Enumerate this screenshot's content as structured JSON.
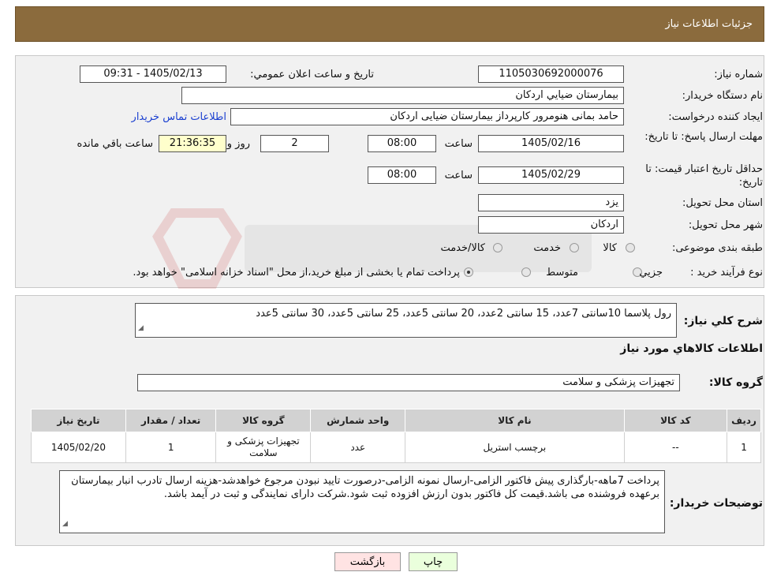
{
  "header": {
    "title": "جزئیات اطلاعات نیاز"
  },
  "form": {
    "need_number": {
      "label": "شماره نیاز:",
      "value": "1105030692000076"
    },
    "announce_datetime": {
      "label": "تاریخ و ساعت اعلان عمومي:",
      "value": "1405/02/13 - 09:31"
    },
    "buyer_org": {
      "label": "نام دستگاه خريدار:",
      "value": "بيمارستان ضيايي اردكان"
    },
    "requester": {
      "label": "ايجاد كننده درخواست:",
      "value": "حامد بمانی هنومرور کارپرداز بیمارستان ضیایی اردکان",
      "contact_link": "اطلاعات تماس خريدار"
    },
    "reply_deadline": {
      "label": "مهلت ارسال پاسخ: تا تاريخ:",
      "date": "1405/02/16",
      "time_label": "ساعت",
      "time": "08:00",
      "days": "2",
      "days_label": "روز و",
      "remaining": "21:36:35",
      "remaining_label": "ساعت باقي مانده"
    },
    "price_validity": {
      "label": "حداقل تاريخ اعتبار قيمت: تا تاريخ:",
      "date": "1405/02/29",
      "time_label": "ساعت",
      "time": "08:00"
    },
    "province": {
      "label": "استان محل تحويل:",
      "value": "يزد"
    },
    "city": {
      "label": "شهر محل تحويل:",
      "value": "اردكان"
    },
    "category": {
      "label": "طبقه بندی موضوعی:",
      "options": [
        "كالا",
        "خدمت",
        "كالا/خدمت"
      ]
    },
    "purchase_type": {
      "label": "نوع فرآيند خريد :",
      "options": [
        "جزيي",
        "متوسط"
      ],
      "note": "پرداخت تمام يا بخشی از مبلغ خريد،از محل \"اسناد خزانه اسلامی\" خواهد بود."
    }
  },
  "summary": {
    "label": "شرح كلي نياز:",
    "value": "رول پلاسما 10سانتی 7عدد، 15 سانتی  2عدد، 20 سانتی  5عدد، 25 سانتی  5عدد، 30 سانتی  5عدد",
    "goods_section_title": "اطلاعات كالاهاي مورد نياز",
    "goods_group_label": "گروه كالا:",
    "goods_group_value": "تجهیزات پزشکی و سلامت"
  },
  "table": {
    "headers": [
      "رديف",
      "كد كالا",
      "نام كالا",
      "واحد شمارش",
      "گروه كالا",
      "تعداد / مقدار",
      "تاريخ نياز"
    ],
    "rows": [
      [
        "1",
        "--",
        "برچسب استریل",
        "عدد",
        "تجهيزات پزشكی و سلامت",
        "1",
        "1405/02/20"
      ]
    ]
  },
  "buyer_notes": {
    "label": "توضيحات خريدار:",
    "value": "پرداخت 7ماهه-بارگذاری پیش فاکتور الزامی-ارسال نمونه الزامی-درصورت تایید نبودن مرجوع خواهدشد-هزینه ارسال تادرب انبار بیمارستان برعهده فروشنده می باشد.قیمت کل فاکتور بدون ارزش افزوده ثبت شود.شرکت دارای نمایندگی و ثبت در آیمد باشد."
  },
  "buttons": {
    "print": "چاپ",
    "back": "بازگشت"
  },
  "colors": {
    "header_bg": "#8b6b3d",
    "print_bg": "#eaffdc",
    "back_bg": "#ffe3e3",
    "link": "#1a3fd0"
  }
}
